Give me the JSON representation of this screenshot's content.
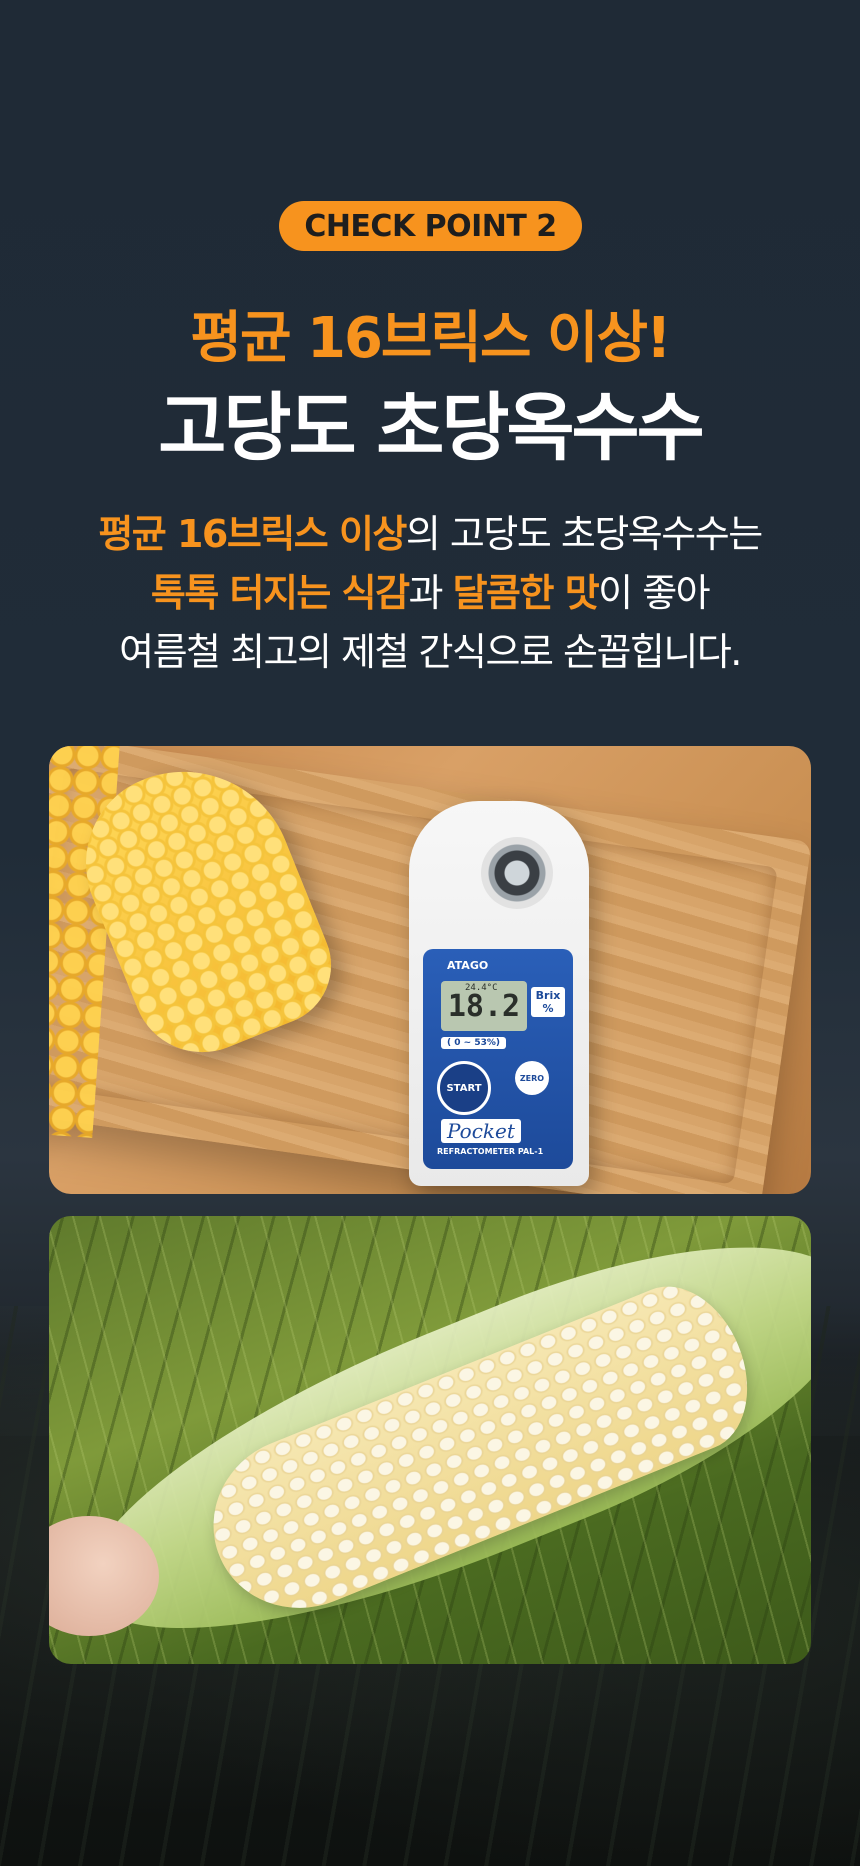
{
  "badge": {
    "label": "CHECK POINT 2"
  },
  "headline": {
    "line1": "평균 16브릭스 이상!",
    "line2": "고당도 초당옥수수"
  },
  "description": {
    "line1_highlight": "평균 16브릭스 이상",
    "line1_rest": "의 고당도 초당옥수수는",
    "line2_highlight1": "톡톡 터지는 식감",
    "line2_mid": "과 ",
    "line2_highlight2": "달콤한 맛",
    "line2_rest": "이 좋아",
    "line3": "여름철 최고의 제철 간식으로 손꼽힙니다."
  },
  "refractometer": {
    "brand": "ATAGO",
    "reading": "18.2",
    "temperature": "24.4°C",
    "unit": "Brix %",
    "range": "( 0 ~ 53%)",
    "start_label": "START",
    "zero_label": "ZERO",
    "product_name": "Pocket",
    "model": "REFRACTOMETER  PAL-1"
  },
  "colors": {
    "accent": "#f7931e",
    "background": "#1f2a35",
    "text": "#ffffff"
  }
}
